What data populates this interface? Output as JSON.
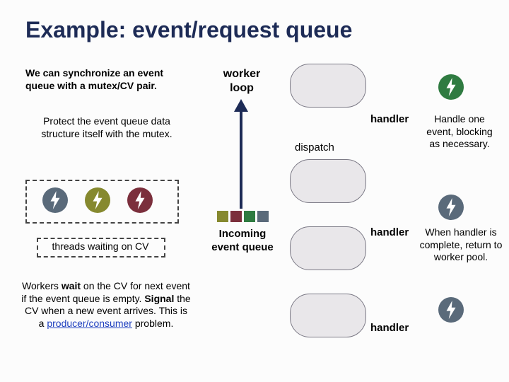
{
  "title": "Example: event/request queue",
  "left": {
    "sync": "We can synchronize an event queue with a mutex/CV pair.",
    "protect": "Protect the event queue data structure itself with the mutex.",
    "waiting_label": "threads waiting on CV",
    "waitpara_a": "Workers ",
    "waitpara_wait": "wait",
    "waitpara_b": " on the CV for next event if the event queue is empty.  ",
    "waitpara_signal": "Signal",
    "waitpara_c": " the CV when a new event arrives.  This is a ",
    "waitpara_pc": "producer/consumer",
    "waitpara_d": " problem."
  },
  "mid": {
    "worker_loop": "worker loop",
    "dispatch": "dispatch",
    "incoming": "Incoming event queue",
    "handler": "handler"
  },
  "right": {
    "handle": "Handle one event, blocking as necessary.",
    "ret": "When handler is complete, return to worker pool."
  },
  "colors": {
    "slate": "#5a6a7a",
    "olive": "#86892f",
    "maroon": "#7b2f3c",
    "green": "#2f7b41"
  }
}
